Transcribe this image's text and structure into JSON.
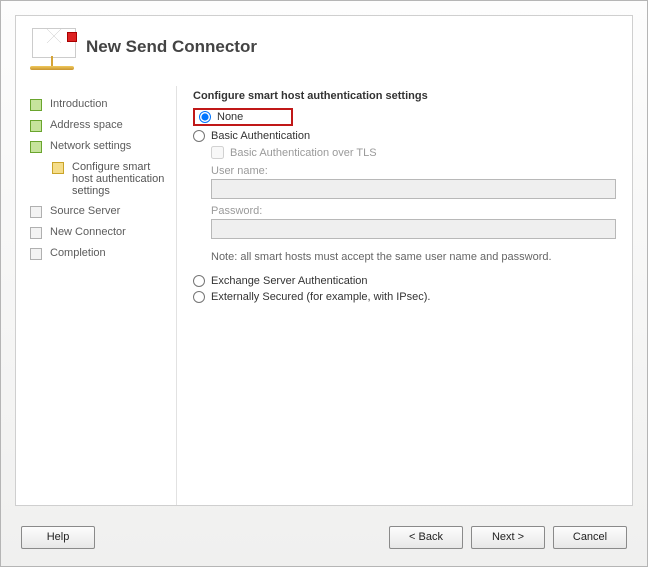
{
  "header": {
    "title": "New Send Connector"
  },
  "sidebar": {
    "items": [
      {
        "label": "Introduction",
        "state": "done"
      },
      {
        "label": "Address space",
        "state": "done"
      },
      {
        "label": "Network settings",
        "state": "done"
      },
      {
        "label": "Configure smart host authentication settings",
        "state": "current"
      },
      {
        "label": "Source Server",
        "state": "pending"
      },
      {
        "label": "New Connector",
        "state": "pending"
      },
      {
        "label": "Completion",
        "state": "pending"
      }
    ]
  },
  "content": {
    "section_title": "Configure smart host authentication settings",
    "radios": {
      "none": "None",
      "basic": "Basic Authentication",
      "basic_tls": "Basic Authentication over TLS",
      "exchange": "Exchange Server Authentication",
      "external": "Externally Secured (for example, with IPsec)."
    },
    "fields": {
      "username_label": "User name:",
      "username_value": "",
      "password_label": "Password:",
      "password_value": ""
    },
    "note": "Note: all smart hosts must accept the same user name and password."
  },
  "footer": {
    "help": "Help",
    "back": "< Back",
    "next": "Next >",
    "cancel": "Cancel"
  }
}
